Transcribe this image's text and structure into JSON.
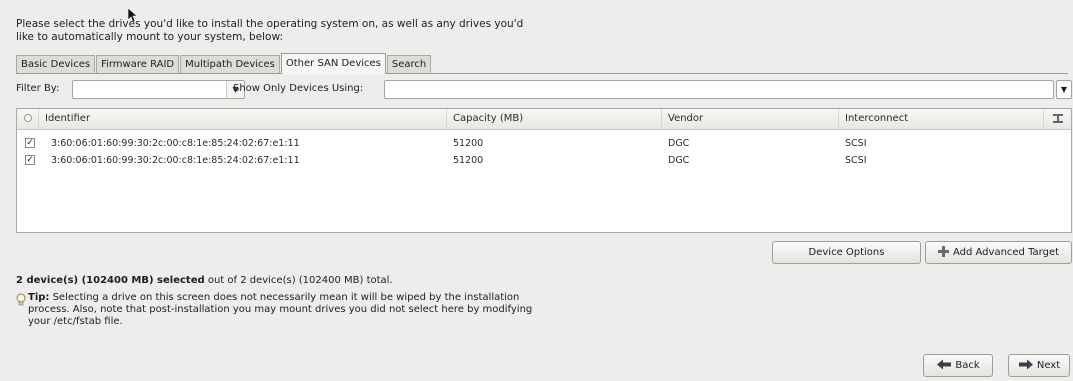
{
  "instruction": "Please select the drives you'd like to install the operating system on, as well as any drives you'd like to automatically mount to your system, below:",
  "tabs": [
    {
      "label": "Basic Devices",
      "active": false
    },
    {
      "label": "Firmware RAID",
      "active": false
    },
    {
      "label": "Multipath Devices",
      "active": false
    },
    {
      "label": "Other SAN Devices",
      "active": true
    },
    {
      "label": "Search",
      "active": false
    }
  ],
  "filter": {
    "filter_by_label": "Filter By:",
    "filter_by_value": "",
    "show_only_label": "Show Only Devices Using:",
    "show_only_value": ""
  },
  "table": {
    "columns": [
      "Identifier",
      "Capacity (MB)",
      "Vendor",
      "Interconnect"
    ],
    "rows": [
      {
        "checked": true,
        "identifier": "3:60:06:01:60:99:30:2c:00:c8:1e:85:24:02:67:e1:11",
        "capacity": "51200",
        "vendor": "DGC",
        "interconnect": "SCSI"
      },
      {
        "checked": true,
        "identifier": "3:60:06:01:60:99:30:2c:00:c8:1e:85:24:02:67:e1:11",
        "capacity": "51200",
        "vendor": "DGC",
        "interconnect": "SCSI"
      }
    ]
  },
  "buttons": {
    "device_options": "Device Options",
    "add_advanced_target": "Add Advanced Target",
    "back": "Back",
    "next": "Next"
  },
  "summary": {
    "bold": "2 device(s) (102400 MB) selected",
    "rest": " out of 2 device(s) (102400 MB) total."
  },
  "tip": {
    "label": "Tip:",
    "text": " Selecting a drive on this screen does not necessarily mean it will be wiped by the installation process.  Also, note that post-installation you may mount drives you did not select here by modifying your /etc/fstab file."
  },
  "icons": {
    "cursor": "mouse-pointer-icon",
    "combo_arrow": "chevron-down-icon",
    "columns": "column-selector-icon",
    "add": "plus-icon",
    "tip": "lightbulb-icon",
    "back": "back-arrow-icon",
    "next": "next-arrow-icon"
  }
}
